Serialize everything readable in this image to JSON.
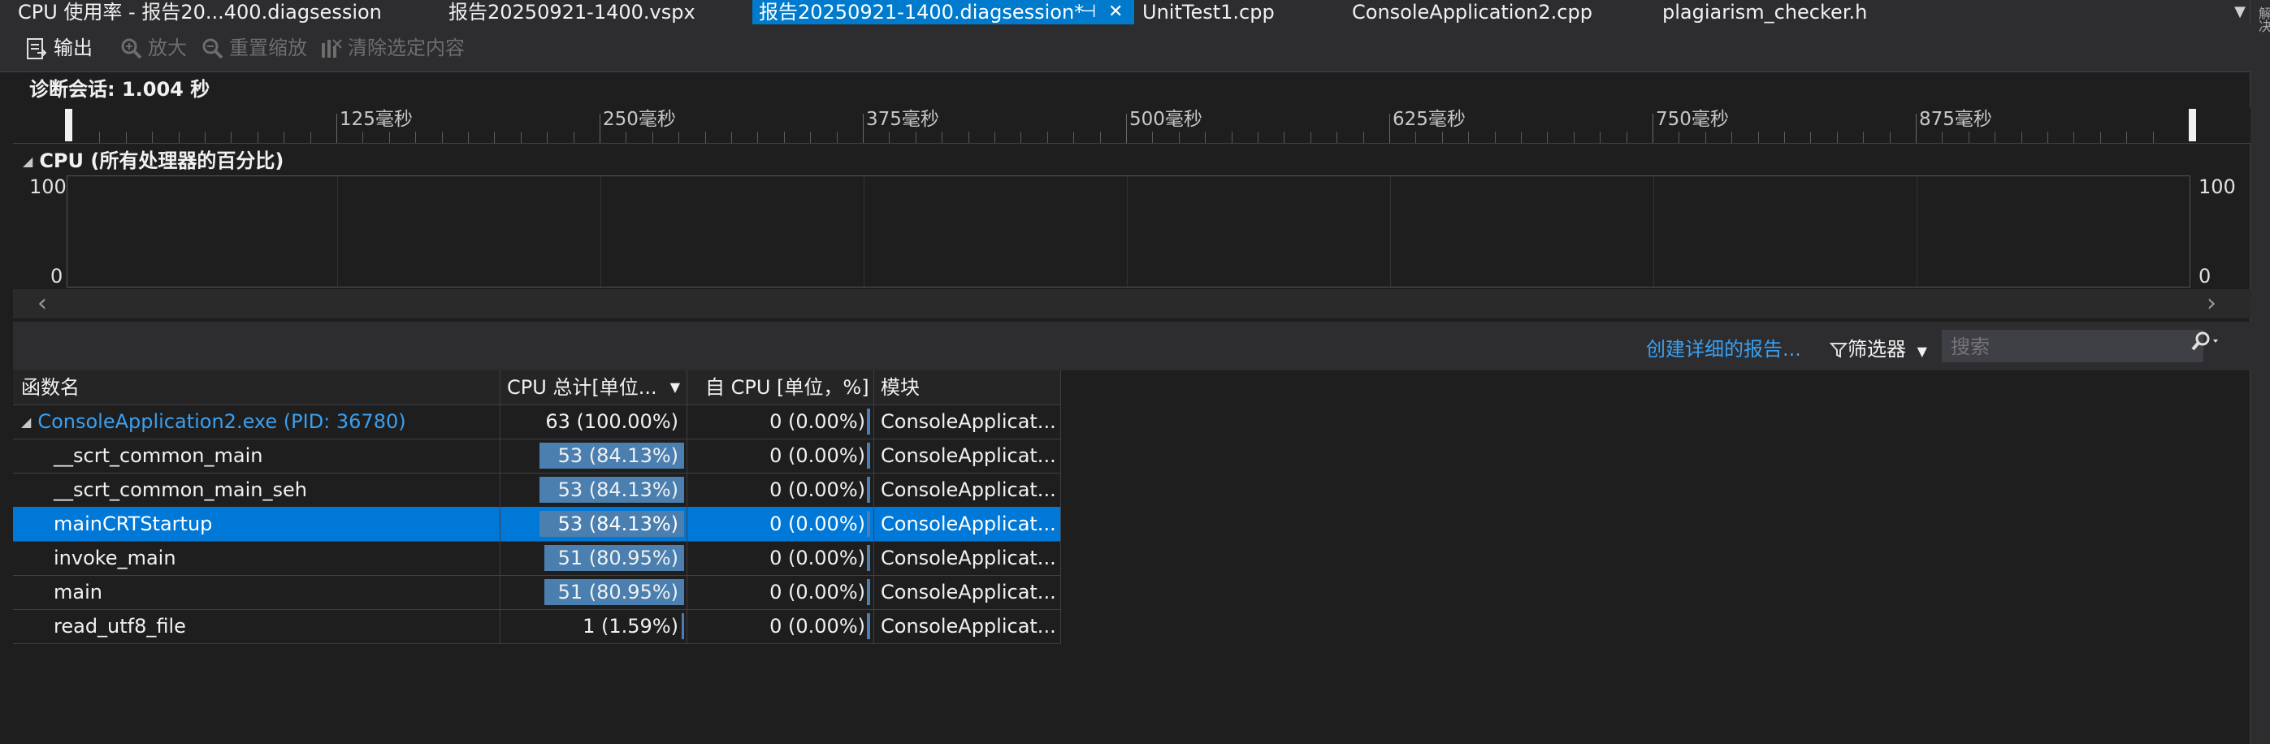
{
  "tabs": [
    {
      "label": "CPU 使用率 - 报告20...400.diagsession",
      "active": false
    },
    {
      "label": "报告20250921-1400.vspx",
      "active": false
    },
    {
      "label": "报告20250921-1400.diagsession*",
      "active": true
    },
    {
      "label": "UnitTest1.cpp",
      "active": false
    },
    {
      "label": "ConsoleApplication2.cpp",
      "active": false
    },
    {
      "label": "plagiarism_checker.h",
      "active": false
    }
  ],
  "tab_pin_glyph": "⊣",
  "tab_close_glyph": "✕",
  "tab_overflow_glyph": "▼",
  "right_strip_label": "解决",
  "toolbar": {
    "output": "输出",
    "zoom_in": "放大",
    "reset_zoom": "重置缩放",
    "clear_selection": "清除选定内容"
  },
  "session": {
    "label": "诊断会话: 1.004 秒"
  },
  "ruler": {
    "ticks": [
      "125毫秒",
      "250毫秒",
      "375毫秒",
      "500毫秒",
      "625毫秒",
      "750毫秒",
      "875毫秒"
    ]
  },
  "cpu_graph": {
    "title": "CPU (所有处理器的百分比)",
    "y_max": "100",
    "y_min": "0"
  },
  "details": {
    "create_report": "创建详细的报告...",
    "filter": "筛选器",
    "search_placeholder": "搜索"
  },
  "table": {
    "columns": [
      "函数名",
      "CPU 总计[单位...",
      "自 CPU [单位，%]",
      "模块"
    ],
    "rows": [
      {
        "name": "ConsoleApplication2.exe (PID: 36780)",
        "total": "63 (100.00%)",
        "total_pct": 100.0,
        "self": "0 (0.00%)",
        "module": "ConsoleApplicat...",
        "is_process": true,
        "selected": false
      },
      {
        "name": "__scrt_common_main",
        "total": "53 (84.13%)",
        "total_pct": 84.13,
        "self": "0 (0.00%)",
        "module": "ConsoleApplicat...",
        "is_process": false,
        "selected": false
      },
      {
        "name": "__scrt_common_main_seh",
        "total": "53 (84.13%)",
        "total_pct": 84.13,
        "self": "0 (0.00%)",
        "module": "ConsoleApplicat...",
        "is_process": false,
        "selected": false
      },
      {
        "name": "mainCRTStartup",
        "total": "53 (84.13%)",
        "total_pct": 84.13,
        "self": "0 (0.00%)",
        "module": "ConsoleApplicat...",
        "is_process": false,
        "selected": true
      },
      {
        "name": "invoke_main",
        "total": "51 (80.95%)",
        "total_pct": 80.95,
        "self": "0 (0.00%)",
        "module": "ConsoleApplicat...",
        "is_process": false,
        "selected": false
      },
      {
        "name": "main",
        "total": "51 (80.95%)",
        "total_pct": 80.95,
        "self": "0 (0.00%)",
        "module": "ConsoleApplicat...",
        "is_process": false,
        "selected": false
      },
      {
        "name": "read_utf8_file",
        "total": "1 (1.59%)",
        "total_pct": 1.59,
        "self": "0 (0.00%)",
        "module": "ConsoleApplicat...",
        "is_process": false,
        "selected": false
      }
    ]
  },
  "colors": {
    "accent": "#007acc",
    "link": "#3aa0f0",
    "bar": "#4a7fb0",
    "selection": "#0078d7"
  }
}
